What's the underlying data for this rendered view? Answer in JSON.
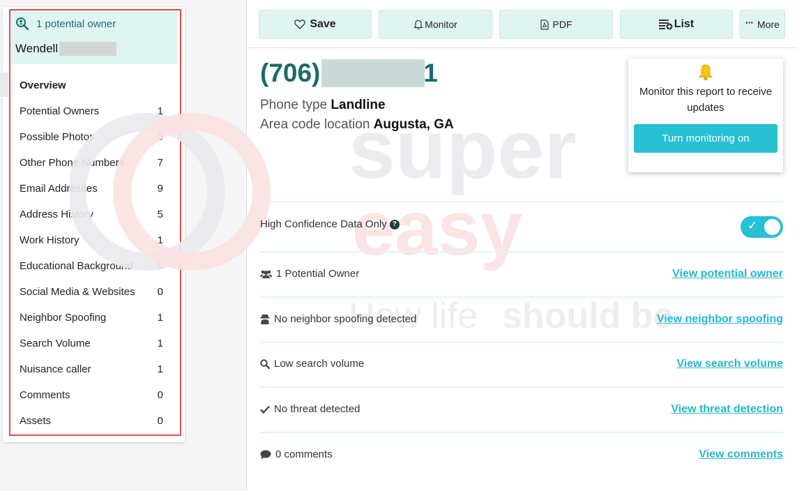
{
  "sidebar": {
    "owner_count_label": "1 potential owner",
    "owner_name": "Wendell",
    "items": [
      {
        "label": "Overview",
        "count": ""
      },
      {
        "label": "Potential Owners",
        "count": "1"
      },
      {
        "label": "Possible Photos",
        "count": "0"
      },
      {
        "label": "Other Phone Numbers",
        "count": "7"
      },
      {
        "label": "Email Addresses",
        "count": "9"
      },
      {
        "label": "Address History",
        "count": "5"
      },
      {
        "label": "Work History",
        "count": "1"
      },
      {
        "label": "Educational Background",
        "count": "0"
      },
      {
        "label": "Social Media & Websites",
        "count": "0"
      },
      {
        "label": "Neighbor Spoofing",
        "count": "1"
      },
      {
        "label": "Search Volume",
        "count": "1"
      },
      {
        "label": "Nuisance caller",
        "count": "1"
      },
      {
        "label": "Comments",
        "count": "0"
      },
      {
        "label": "Assets",
        "count": "0"
      }
    ]
  },
  "toolbar": {
    "save": "Save",
    "monitor": "Monitor",
    "pdf": "PDF",
    "list": "List",
    "more": "More"
  },
  "report": {
    "phone_prefix": "(706)",
    "phone_suffix": "1",
    "phone_type_label": "Phone type",
    "phone_type_value": "Landline",
    "area_code_label": "Area code location",
    "area_code_value": "Augusta, GA"
  },
  "monitor_popup": {
    "text": "Monitor this report to receive updates",
    "button": "Turn monitoring on"
  },
  "watermark": {
    "brand_top": "super",
    "brand_bottom": "easy",
    "tagline_left": "How life",
    "tagline_right": "should be"
  },
  "rows": {
    "confidence_label": "High Confidence Data Only",
    "confidence_on": true,
    "owner_label": "1 Potential Owner",
    "owner_link": "View potential owner",
    "spoof_label": "No neighbor spoofing detected",
    "spoof_link": "View neighbor spoofing",
    "search_label": "Low search volume",
    "search_link": "View search volume",
    "threat_label": "No threat detected",
    "threat_link": "View threat detection",
    "comments_label": "0 comments",
    "comments_link": "View comments"
  },
  "colors": {
    "accent": "#27c0d5",
    "teal_dark": "#1a6b68",
    "mint_bg": "#dff5f2",
    "highlight_outline": "#e34b4b"
  }
}
